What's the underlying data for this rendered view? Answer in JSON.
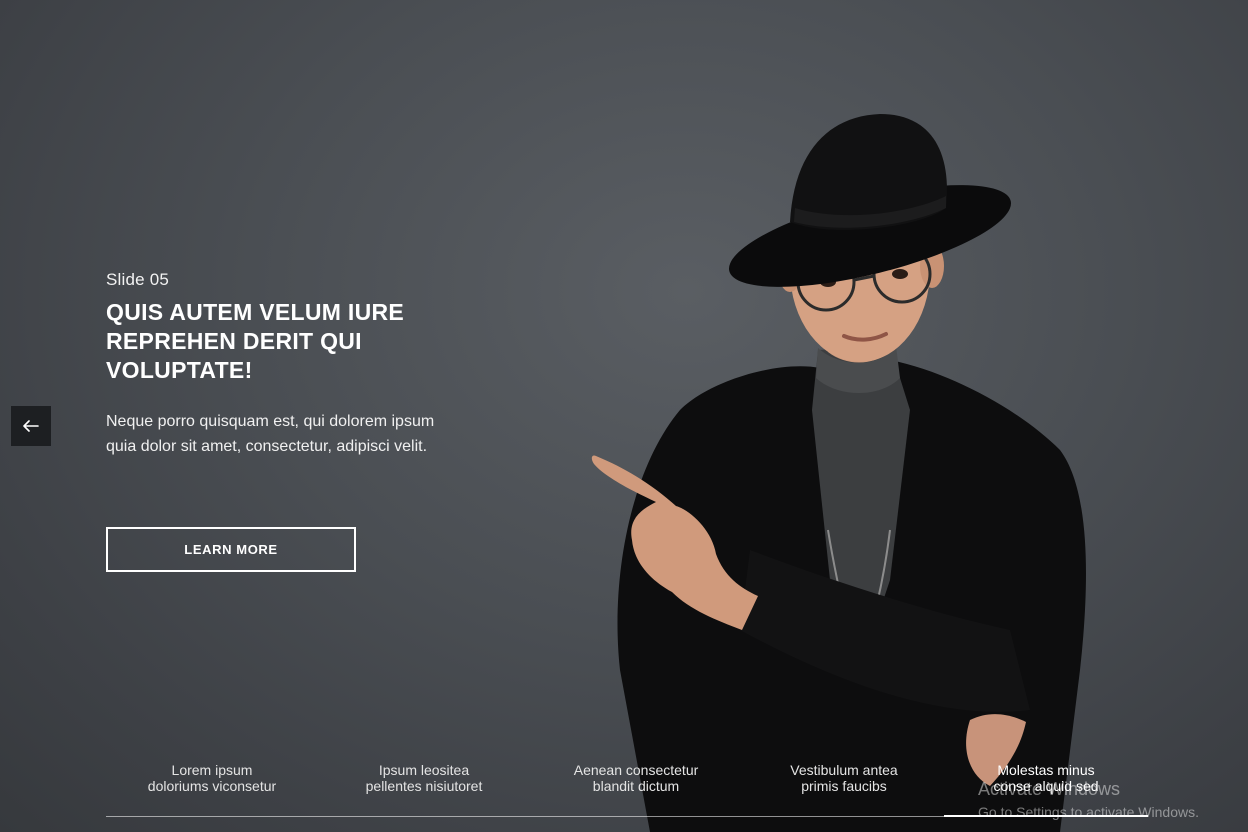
{
  "slide": {
    "label": "Slide 05",
    "title": "QUIS AUTEM VELUM IURE REPREHEN DERIT QUI VOLUPTATE!",
    "description": "Neque porro quisquam est, qui dolorem ipsum quia dolor sit amet, consectetur, adipisci velit.",
    "button_label": "LEARN MORE"
  },
  "navigation": {
    "prev_icon": "arrow-left-icon"
  },
  "thumbnails": [
    {
      "line1": "Lorem ipsum",
      "line2": "doloriums viconsetur"
    },
    {
      "line1": "Ipsum leositea",
      "line2": "pellentes nisiutoret"
    },
    {
      "line1": "Aenean consectetur",
      "line2": "blandit dictum"
    },
    {
      "line1": "Vestibulum antea",
      "line2": "primis faucibs"
    },
    {
      "line1": "Molestas minus",
      "line2": "conse alquid sed"
    }
  ],
  "active_thumbnail_index": 4,
  "watermark": {
    "title": "Activate Windows",
    "subtitle": "Go to Settings to activate Windows."
  },
  "colors": {
    "background": "#4a4e53",
    "text": "#ffffff",
    "prev_button_bg": "#1d1f22"
  }
}
